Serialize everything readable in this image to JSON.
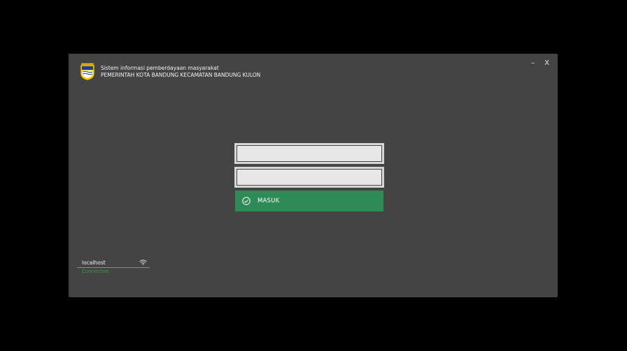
{
  "header": {
    "app_title": "Sistem informasi pemberdayaan masyarakat",
    "org_title": "PEMERINTAH KOTA BANDUNG KECAMATAN BANDUNG KULON",
    "logo_icon": "bandung-city-emblem-icon"
  },
  "window_controls": {
    "minimize_label": "–",
    "close_label": "X"
  },
  "login": {
    "username_value": "",
    "password_value": "",
    "submit_label": "MASUK",
    "submit_icon": "check-circle-icon"
  },
  "server": {
    "host": "localhost",
    "status": "Connected",
    "status_icon": "wifi-icon"
  },
  "colors": {
    "background": "#000000",
    "window": "#444444",
    "accent_green": "#2e8b57",
    "status_green": "#2e9e3e",
    "field": "#e7e7e7"
  }
}
